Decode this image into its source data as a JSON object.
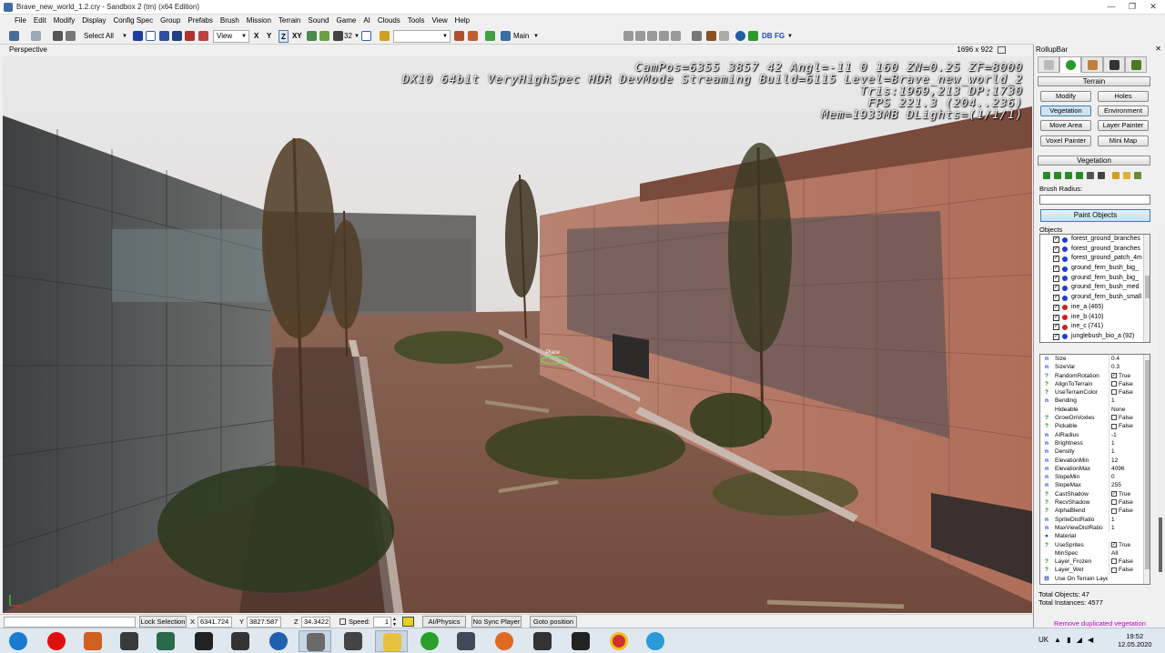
{
  "window": {
    "title": "Brave_new_world_1.2.cry - Sandbox 2 (tm) (x64 Edition)",
    "min_glyph": "—",
    "max_glyph": "❐",
    "close_glyph": "✕"
  },
  "menu": [
    "File",
    "Edit",
    "Modify",
    "Display",
    "Config Spec",
    "Group",
    "Prefabs",
    "Brush",
    "Mission",
    "Terrain",
    "Sound",
    "Game",
    "AI",
    "Clouds",
    "Tools",
    "View",
    "Help"
  ],
  "toolbar": {
    "select_all": "Select All",
    "coord_view": "View",
    "axis_x": "X",
    "axis_y": "Y",
    "axis_z": "Z",
    "axis_xy": "XY",
    "grid_size": "32",
    "layer": "Main",
    "db": "DB",
    "fg": "FG"
  },
  "viewport": {
    "label": "Perspective",
    "resolution": "1696 x 922",
    "hud_lines": [
      "CamPos=6355 3857   42 Angl=-11   0 160 ZN=0.25 ZF=8000",
      "DX10 64bit VeryHighSpec HDR DevMode Streaming Build=6115 Level=Brave_new_world_2",
      "Tris:1969,213  DP:1730",
      "FPS 221.3 (204..236)",
      "Mem=1933MB DLights=(1/1/1)"
    ],
    "place_label": "Place"
  },
  "statusbar": {
    "lock_selection": "Lock Selection",
    "x_label": "X",
    "x_value": "6341.724",
    "y_label": "Y",
    "y_value": "3827.587",
    "z_label": "Z",
    "z_value": "34.3422",
    "speed_label": "Speed:",
    "speed_value": "1",
    "ai_physics": "AI/Physics",
    "no_sync_player": "No Sync Player",
    "goto_position": "Goto position"
  },
  "rollup": {
    "title": "RollupBar",
    "close_glyph": "✕",
    "terrain_header": "Terrain",
    "buttons": {
      "modify": "Modify",
      "holes": "Holes",
      "vegetation": "Vegetation",
      "environment": "Environment",
      "move_area": "Move Area",
      "layer_painter": "Layer Painter",
      "voxel_painter": "Voxel Painter",
      "mini_map": "Mini Map"
    },
    "vegetation_header": "Vegetation",
    "brush_radius_label": "Brush Radius:",
    "paint_objects": "Paint Objects",
    "objects_label": "Objects",
    "objects": [
      {
        "name": "forest_ground_branches",
        "color": "#1f3fd0"
      },
      {
        "name": "forest_ground_branches",
        "color": "#1f3fd0"
      },
      {
        "name": "forest_ground_patch_4m",
        "color": "#1f3fd0"
      },
      {
        "name": "ground_fern_bush_big_",
        "color": "#1f3fd0"
      },
      {
        "name": "ground_fern_bush_big_",
        "color": "#1f3fd0"
      },
      {
        "name": "ground_fern_bush_med",
        "color": "#1f3fd0"
      },
      {
        "name": "ground_fern_bush_small",
        "color": "#1f3fd0"
      },
      {
        "name": "ine_a (465)",
        "color": "#d02020"
      },
      {
        "name": "ine_b (410)",
        "color": "#d02020"
      },
      {
        "name": "ine_c (741)",
        "color": "#d02020"
      },
      {
        "name": "junglebush_bio_a (92)",
        "color": "#1f3fd0"
      }
    ],
    "properties": [
      {
        "type": "n",
        "name": "Size",
        "value": "0.4"
      },
      {
        "type": "n",
        "name": "SizeVar",
        "value": "0.3"
      },
      {
        "type": "?",
        "name": "RandomRotation",
        "value": "True",
        "check": "✓"
      },
      {
        "type": "?",
        "name": "AlignToTerrain",
        "value": "False",
        "check": ""
      },
      {
        "type": "?",
        "name": "UseTerrainColor",
        "value": "False",
        "check": ""
      },
      {
        "type": "n",
        "name": "Bending",
        "value": "1"
      },
      {
        "type": "",
        "name": "Hideable",
        "value": "None"
      },
      {
        "type": "?",
        "name": "GrowOnVoxles",
        "value": "False",
        "check": ""
      },
      {
        "type": "?",
        "name": "Pickable",
        "value": "False",
        "check": ""
      },
      {
        "type": "n",
        "name": "AIRadius",
        "value": "-1"
      },
      {
        "type": "n",
        "name": "Brightness",
        "value": "1"
      },
      {
        "type": "n",
        "name": "Density",
        "value": "1"
      },
      {
        "type": "n",
        "name": "ElevationMin",
        "value": "12"
      },
      {
        "type": "n",
        "name": "ElevationMax",
        "value": "4096"
      },
      {
        "type": "n",
        "name": "SlopeMin",
        "value": "0"
      },
      {
        "type": "n",
        "name": "SlopeMax",
        "value": "255"
      },
      {
        "type": "?",
        "name": "CastShadow",
        "value": "True",
        "check": "✓"
      },
      {
        "type": "?",
        "name": "RecvShadow",
        "value": "False",
        "check": ""
      },
      {
        "type": "?",
        "name": "AlphaBlend",
        "value": "False",
        "check": ""
      },
      {
        "type": "n",
        "name": "SpriteDistRatio",
        "value": "1"
      },
      {
        "type": "n",
        "name": "MaxViewDistRatio",
        "value": "1"
      },
      {
        "type": "●",
        "name": "Material",
        "value": ""
      },
      {
        "type": "?",
        "name": "UseSprites",
        "value": "True",
        "check": "✓"
      },
      {
        "type": "",
        "name": "MinSpec",
        "value": "All"
      },
      {
        "type": "?",
        "name": "Layer_Frozen",
        "value": "False",
        "check": ""
      },
      {
        "type": "?",
        "name": "Layer_Wet",
        "value": "False",
        "check": ""
      },
      {
        "type": "⊟",
        "name": "Use On Terrain Layers",
        "value": ""
      }
    ],
    "total_objects": "Total Objects: 47",
    "total_instances": "Total Instances: 4577",
    "remove_duplicated": "Remove duplicated vegetation"
  },
  "taskbar": {
    "apps": [
      "start",
      "opera",
      "maple",
      "glyph",
      "plant",
      "m-app",
      "inkscape",
      "web",
      "sandbox",
      "x-app",
      "files",
      "torrent",
      "code",
      "firefox",
      "cam",
      "sm",
      "chrome",
      "telegram"
    ],
    "lang": "UK",
    "time": "19:52",
    "date": "12.05.2020"
  }
}
